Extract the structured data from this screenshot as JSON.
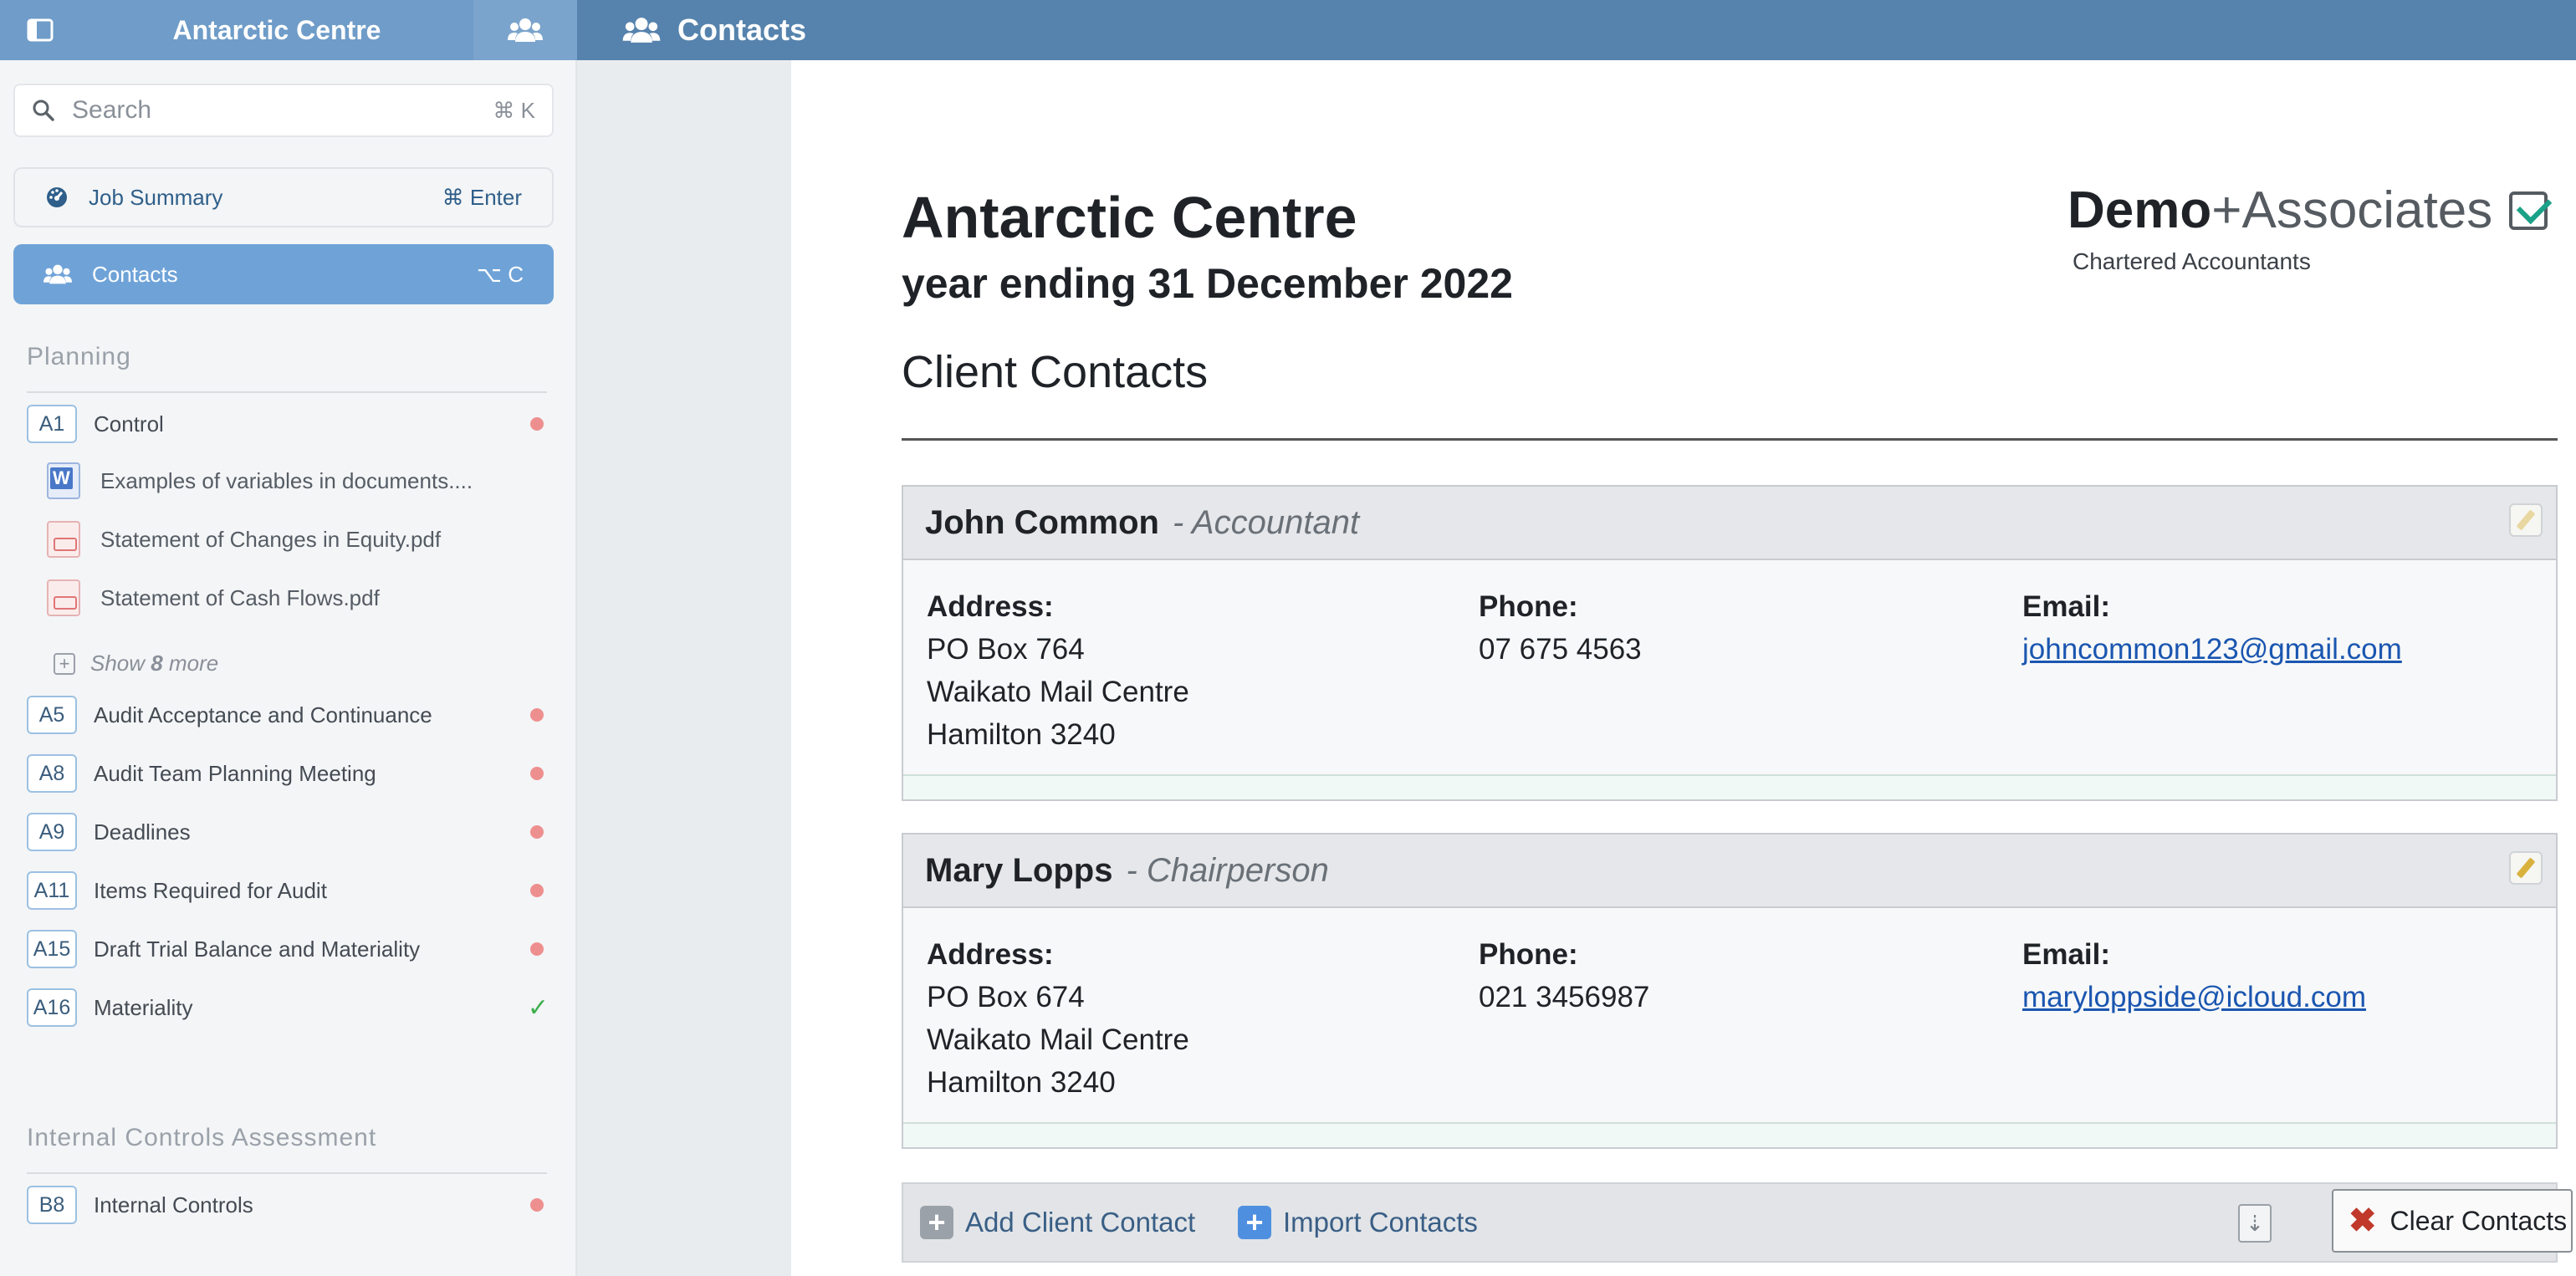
{
  "topbar": {
    "title": "Antarctic Centre",
    "page_title": "Contacts",
    "sidebar_toggle_icon": "sidebar-toggle-icon",
    "users_icon": "users-icon"
  },
  "sidebar": {
    "search": {
      "placeholder": "Search",
      "shortcut": "⌘ K"
    },
    "nav": [
      {
        "label": "Job Summary",
        "shortcut": "⌘ Enter",
        "icon": "dashboard-icon"
      },
      {
        "label": "Contacts",
        "shortcut": "⌥ C",
        "icon": "users-icon",
        "active": true
      }
    ],
    "sections": [
      {
        "title": "Planning",
        "items": [
          {
            "code": "A1",
            "name": "Control",
            "status": "incomplete"
          },
          {
            "code": "A5",
            "name": "Audit Acceptance and Continuance",
            "status": "incomplete"
          },
          {
            "code": "A8",
            "name": "Audit Team Planning Meeting",
            "status": "incomplete"
          },
          {
            "code": "A9",
            "name": "Deadlines",
            "status": "incomplete"
          },
          {
            "code": "A11",
            "name": "Items Required for Audit",
            "status": "incomplete"
          },
          {
            "code": "A15",
            "name": "Draft Trial Balance and Materiality",
            "status": "incomplete"
          },
          {
            "code": "A16",
            "name": "Materiality",
            "status": "complete"
          }
        ],
        "files": [
          {
            "name": "Examples of variables in documents....",
            "type": "word"
          },
          {
            "name": "Statement of Changes in Equity.pdf",
            "type": "pdf"
          },
          {
            "name": "Statement of Cash Flows.pdf",
            "type": "pdf"
          }
        ],
        "show_more": {
          "prefix": "Show",
          "count": "8",
          "suffix": "more"
        }
      },
      {
        "title": "Internal Controls Assessment",
        "items": [
          {
            "code": "B8",
            "name": "Internal Controls",
            "status": "incomplete"
          }
        ]
      }
    ]
  },
  "document": {
    "title": "Antarctic Centre",
    "subtitle": "year ending 31 December 2022",
    "heading": "Client Contacts",
    "logo": {
      "brand_bold": "Demo",
      "brand_rest": "+Associates",
      "tagline": "Chartered Accountants"
    },
    "labels": {
      "address": "Address:",
      "phone": "Phone:",
      "email": "Email:"
    },
    "contacts": [
      {
        "name": "John Common",
        "role": "- Accountant",
        "address": [
          "PO Box 764",
          "Waikato Mail Centre",
          "Hamilton 3240"
        ],
        "phone": "07 675 4563",
        "email": "johncommon123@gmail.com"
      },
      {
        "name": "Mary Lopps",
        "role": "- Chairperson",
        "address": [
          "PO Box 674",
          "Waikato Mail Centre",
          "Hamilton 3240"
        ],
        "phone": "021 3456987",
        "email": "maryloppside@icloud.com"
      }
    ],
    "actions": {
      "add": "Add Client Contact",
      "import": "Import Contacts",
      "clear": "Clear Contacts"
    }
  },
  "colors": {
    "topbar": "#5683ad",
    "accent": "#6fa3d8",
    "status_incomplete": "#ee8f8f",
    "status_complete": "#40b050"
  }
}
